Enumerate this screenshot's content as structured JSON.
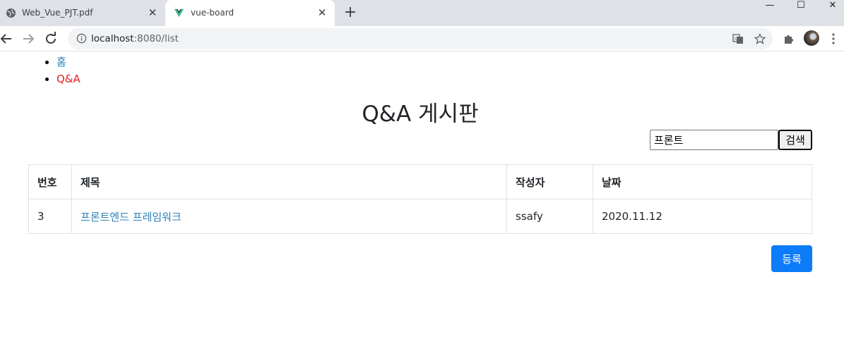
{
  "browser": {
    "tabs": [
      {
        "title": "Web_Vue_PJT.pdf",
        "active": false,
        "icon": "globe-icon"
      },
      {
        "title": "vue-board",
        "active": true,
        "icon": "vue-logo-icon"
      }
    ],
    "new_tab_label": "+",
    "close_glyph": "✕",
    "window_controls": {
      "minimize": "—",
      "maximize": "☐",
      "close": "✕"
    },
    "url_host": "localhost",
    "url_path": ":8080/list",
    "accent_colors": {
      "tab_strip": "#dee1e6",
      "vue_green": "#41b883",
      "vue_dark": "#34495e"
    }
  },
  "nav": {
    "items": [
      {
        "label": "홈",
        "color": "#2c80b9"
      },
      {
        "label": "Q&A",
        "color": "#e0211e"
      }
    ]
  },
  "board": {
    "title": "Q&A 게시판",
    "search": {
      "value": "프론트",
      "button_label": "검색"
    },
    "columns": [
      "번호",
      "제목",
      "작성자",
      "날짜"
    ],
    "rows": [
      {
        "no": "3",
        "title": "프론트엔드 프레임워크",
        "author": "ssafy",
        "date": "2020.11.12"
      }
    ],
    "register_label": "등록",
    "register_color": "#0d7cf8"
  }
}
